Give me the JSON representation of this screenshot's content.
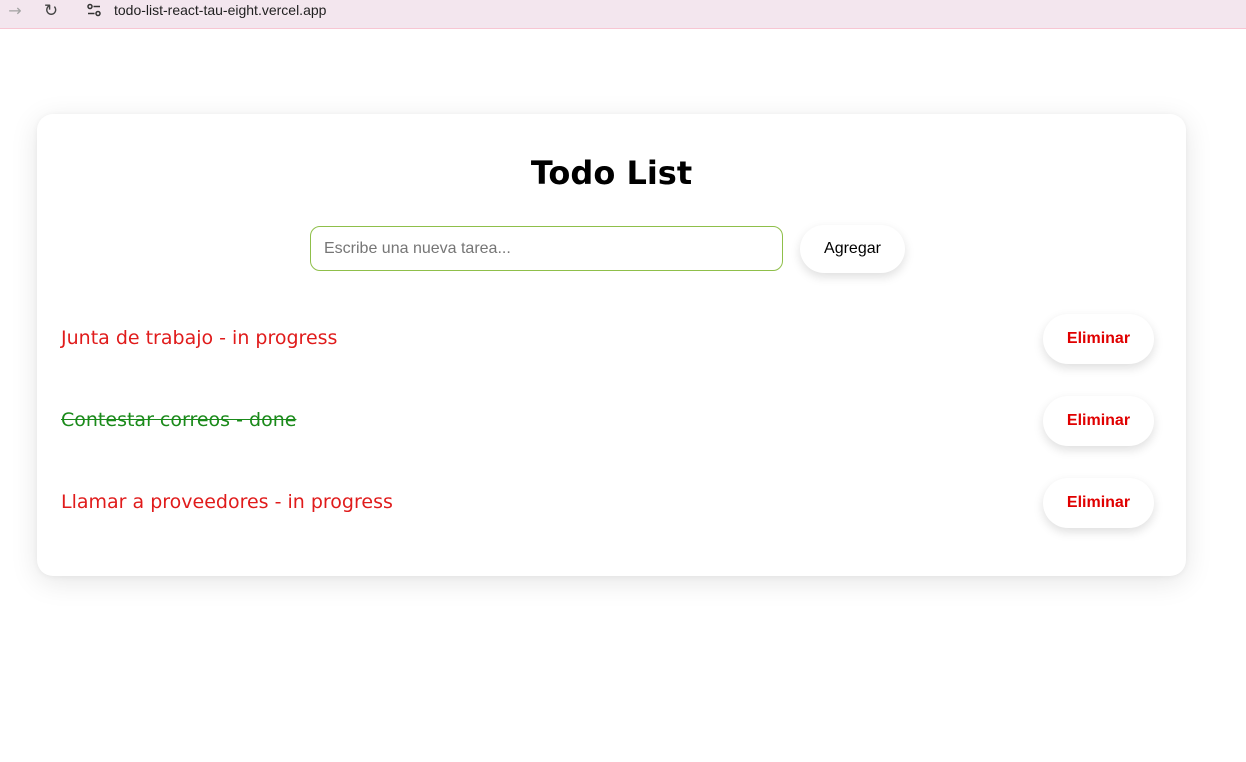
{
  "browser": {
    "url": "todo-list-react-tau-eight.vercel.app",
    "forward_icon": "arrow-right-icon",
    "reload_icon": "reload-icon",
    "site_info_icon": "site-settings-icon"
  },
  "app": {
    "title": "Todo List",
    "input": {
      "placeholder": "Escribe una nueva tarea...",
      "value": ""
    },
    "add_label": "Agregar"
  },
  "tasks": [
    {
      "text": "Junta de trabajo - in progress",
      "status": "in progress",
      "color": "#e01b1b",
      "delete_label": "Eliminar"
    },
    {
      "text": "Contestar correos - done",
      "status": "done",
      "color": "#1a8a1a",
      "delete_label": "Eliminar"
    },
    {
      "text": "Llamar a proveedores - in progress",
      "status": "in progress",
      "color": "#e01b1b",
      "delete_label": "Eliminar"
    }
  ],
  "colors": {
    "in_progress": "#e01b1b",
    "done": "#1a8a1a",
    "delete": "#e00000",
    "input_border": "#8fbf4a"
  }
}
